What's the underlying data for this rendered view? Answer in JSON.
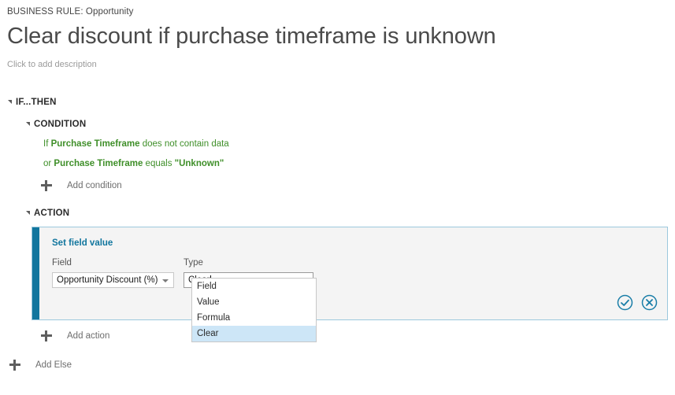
{
  "header": {
    "breadcrumb": "BUSINESS RULE: Opportunity",
    "title": "Clear discount if purchase timeframe is unknown",
    "description_placeholder": "Click to add description"
  },
  "tree": {
    "if_then": {
      "label": "IF...THEN"
    },
    "condition": {
      "label": "CONDITION",
      "lines": [
        {
          "prefix": "If ",
          "field": "Purchase Timeframe",
          "operator": " does not contain data",
          "value": ""
        },
        {
          "prefix": "or ",
          "field": "Purchase Timeframe",
          "operator": " equals ",
          "value": "\"Unknown\""
        }
      ],
      "add_label": "Add condition"
    },
    "action": {
      "label": "ACTION",
      "add_label": "Add action",
      "card": {
        "title": "Set field value",
        "field": {
          "label": "Field",
          "value": "Opportunity Discount (%)"
        },
        "type": {
          "label": "Type",
          "value": "Clear",
          "options": [
            "Field",
            "Value",
            "Formula",
            "Clear"
          ],
          "selected_option": "Clear"
        },
        "confirm_icon": "check-circle-icon",
        "cancel_icon": "x-circle-icon"
      }
    },
    "add_else_label": "Add Else"
  },
  "colors": {
    "accent_teal": "#11769e",
    "condition_green": "#3f8f29",
    "card_border": "#9cc8dd",
    "card_background": "#f4f4f4",
    "dropdown_highlight": "#cde6f7"
  }
}
